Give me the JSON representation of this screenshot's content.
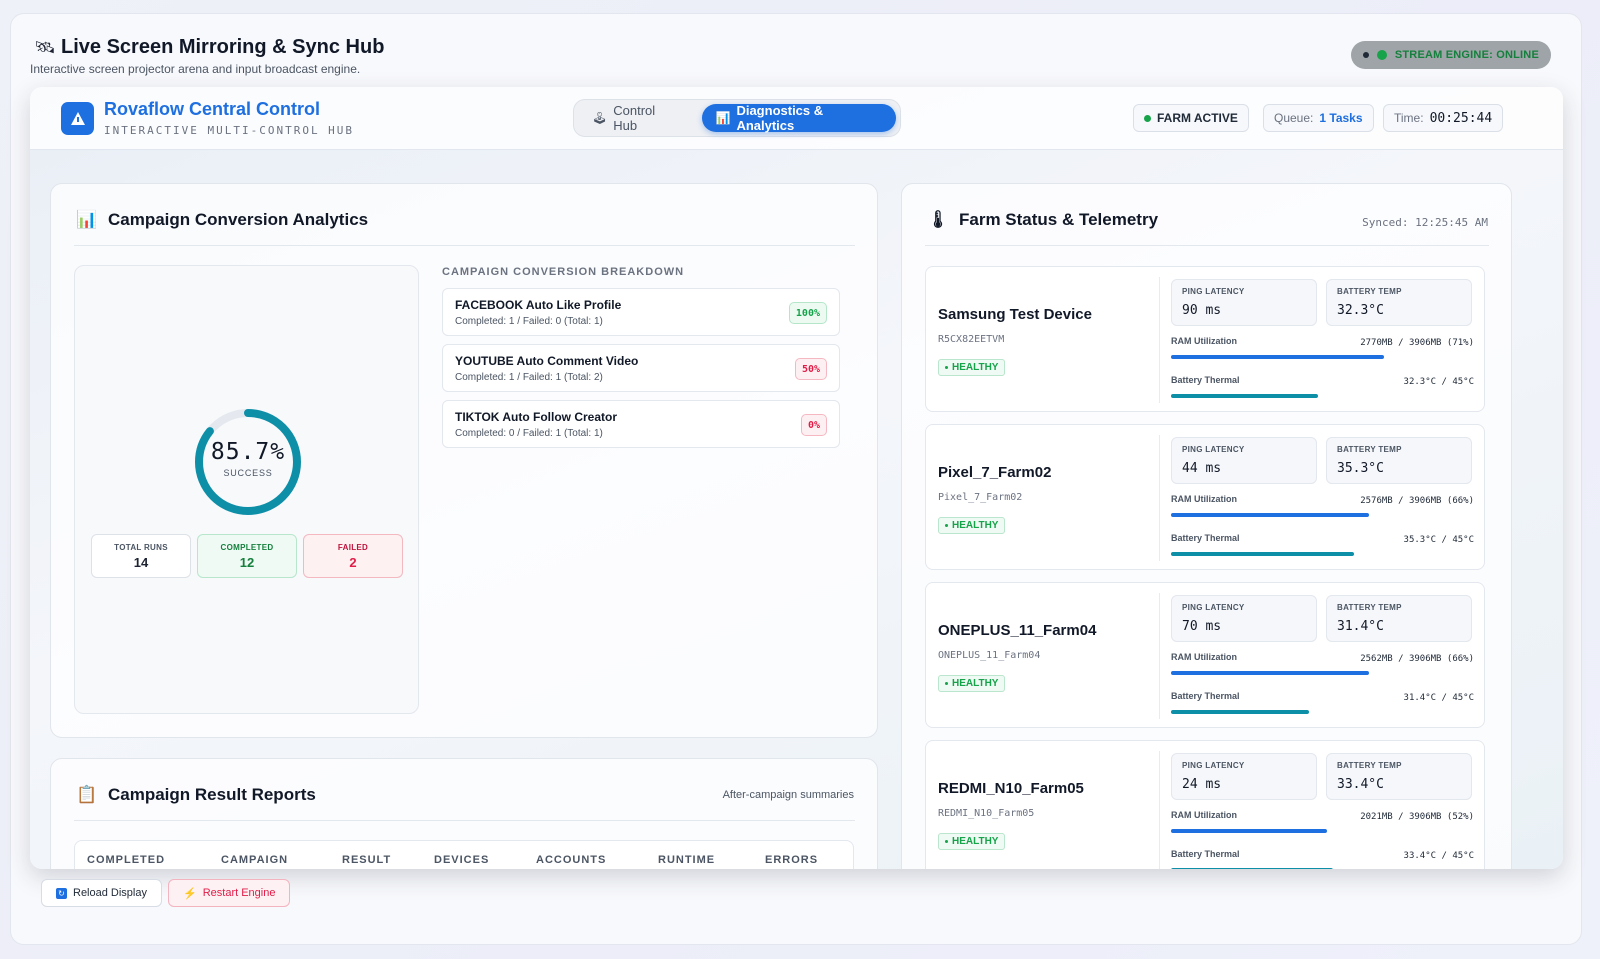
{
  "shell": {
    "title": "Live Screen Mirroring & Sync Hub",
    "title_icon": "satellite-icon",
    "subtitle": "Interactive screen projector arena and input broadcast engine.",
    "engine_status": "STREAM ENGINE: ONLINE"
  },
  "app": {
    "brand": "Rovaflow Central Control",
    "brand_sub": "INTERACTIVE MULTI-CONTROL HUB",
    "tabs": [
      {
        "label": "Control Hub",
        "icon": "joystick-icon",
        "active": false
      },
      {
        "label": "Diagnostics & Analytics",
        "icon": "bar-chart-icon",
        "active": true
      }
    ],
    "farm_status": "FARM ACTIVE",
    "queue_label": "Queue:",
    "queue_value": "1 Tasks",
    "time_label": "Time:",
    "time_value": "00:25:44"
  },
  "analytics": {
    "title": "Campaign Conversion Analytics",
    "success_rate": "85.7%",
    "success_fraction": 0.857,
    "success_label": "SUCCESS",
    "stats": {
      "total_label": "TOTAL RUNS",
      "total_value": "14",
      "completed_label": "COMPLETED",
      "completed_value": "12",
      "failed_label": "FAILED",
      "failed_value": "2"
    },
    "breakdown_title": "CAMPAIGN CONVERSION BREAKDOWN",
    "breakdown": [
      {
        "name": "FACEBOOK Auto Like Profile",
        "summary": "Completed: 1 / Failed: 0 (Total: 1)",
        "pct": "100%",
        "status": "good"
      },
      {
        "name": "YOUTUBE Auto Comment Video",
        "summary": "Completed: 1 / Failed: 1 (Total: 2)",
        "pct": "50%",
        "status": "bad"
      },
      {
        "name": "TIKTOK Auto Follow Creator",
        "summary": "Completed: 0 / Failed: 1 (Total: 1)",
        "pct": "0%",
        "status": "bad"
      }
    ]
  },
  "reports": {
    "title": "Campaign Result Reports",
    "note": "After-campaign summaries",
    "columns": [
      "COMPLETED",
      "CAMPAIGN",
      "RESULT",
      "DEVICES",
      "ACCOUNTS",
      "RUNTIME",
      "ERRORS"
    ]
  },
  "farm": {
    "title": "Farm Status & Telemetry",
    "synced": "Synced: 12:25:45 AM",
    "ping_label": "PING LATENCY",
    "temp_label": "BATTERY TEMP",
    "ram_label": "RAM Utilization",
    "thermal_label": "Battery Thermal",
    "devices": [
      {
        "name": "Samsung Test Device",
        "serial": "R5CX82EETVM",
        "health": "HEALTHY",
        "ping": "90 ms",
        "temp": "32.3°C",
        "ram": "2770MB / 3906MB (71%)",
        "ram_fraction": 0.71,
        "thermal": "32.3°C / 45°C",
        "thermal_fraction": 0.49
      },
      {
        "name": "Pixel_7_Farm02",
        "serial": "Pixel_7_Farm02",
        "health": "HEALTHY",
        "ping": "44 ms",
        "temp": "35.3°C",
        "ram": "2576MB / 3906MB (66%)",
        "ram_fraction": 0.66,
        "thermal": "35.3°C / 45°C",
        "thermal_fraction": 0.61
      },
      {
        "name": "ONEPLUS_11_Farm04",
        "serial": "ONEPLUS_11_Farm04",
        "health": "HEALTHY",
        "ping": "70 ms",
        "temp": "31.4°C",
        "ram": "2562MB / 3906MB (66%)",
        "ram_fraction": 0.66,
        "thermal": "31.4°C / 45°C",
        "thermal_fraction": 0.46
      },
      {
        "name": "REDMI_N10_Farm05",
        "serial": "REDMI_N10_Farm05",
        "health": "HEALTHY",
        "ping": "24 ms",
        "temp": "33.4°C",
        "ram": "2021MB / 3906MB (52%)",
        "ram_fraction": 0.52,
        "thermal": "33.4°C / 45°C",
        "thermal_fraction": 0.54
      }
    ]
  },
  "footer": {
    "reload_label": "Reload Display",
    "restart_label": "Restart Engine"
  },
  "colors": {
    "accent": "#1e6fe0",
    "success": "#16a34a",
    "danger": "#e11d48",
    "donut": "#0e8fa8"
  }
}
